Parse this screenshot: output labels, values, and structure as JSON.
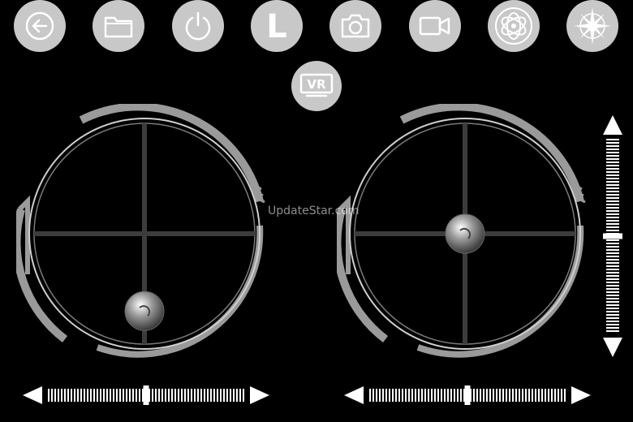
{
  "toolbar": {
    "buttons": [
      {
        "name": "back-button",
        "icon": "back-arrow-icon"
      },
      {
        "name": "folder-button",
        "icon": "folder-icon"
      },
      {
        "name": "power-button",
        "icon": "power-icon"
      },
      {
        "name": "mode-l-button",
        "icon": "letter-l-icon",
        "label": "L"
      },
      {
        "name": "camera-button",
        "icon": "camera-icon"
      },
      {
        "name": "video-button",
        "icon": "video-camera-icon"
      },
      {
        "name": "gyro-button",
        "icon": "gyroscope-icon"
      },
      {
        "name": "compass-button",
        "icon": "compass-icon"
      }
    ]
  },
  "vr_button": {
    "label": "VR",
    "icon": "vr-headset-icon"
  },
  "left_joystick": {
    "x_level": 0.0,
    "y_level": -0.85
  },
  "right_joystick": {
    "x_level": 0.0,
    "y_level": 0.0
  },
  "left_trim": {
    "level": 0.5
  },
  "right_trim": {
    "level": 0.5
  },
  "vertical_trim": {
    "level": 0.5
  },
  "watermark": "UpdateStar.com",
  "colors": {
    "background": "#000000",
    "button": "#c8c8c8",
    "icon": "#ffffff",
    "ring": "#9a9a9a",
    "crosshair": "#3c3c3c"
  }
}
